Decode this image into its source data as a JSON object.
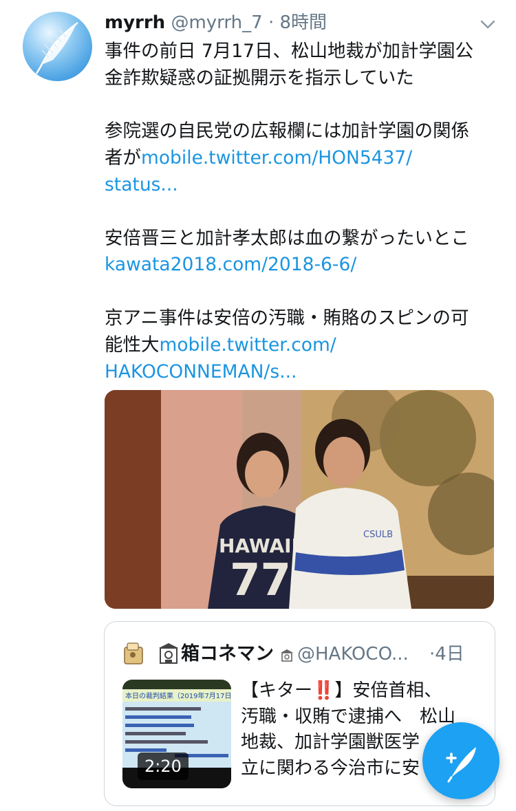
{
  "tweet": {
    "author_name": "myrrh",
    "author_handle": "@myrrh_7",
    "separator": "·",
    "time": "8時間",
    "lines": [
      {
        "parts": [
          {
            "t": "事件の前日 7月17日、松山地裁が加計学園公",
            "link": false
          }
        ]
      },
      {
        "parts": [
          {
            "t": "金詐欺疑惑の証拠開示を指示していた",
            "link": false
          }
        ]
      },
      {
        "gap": true
      },
      {
        "parts": [
          {
            "t": "参院選の自民党の広報欄には加計学園の関係",
            "link": false
          }
        ]
      },
      {
        "parts": [
          {
            "t": "者が",
            "link": false
          },
          {
            "t": "mobile.twitter.com/HON5437/",
            "link": true
          }
        ]
      },
      {
        "parts": [
          {
            "t": "status...",
            "link": true
          }
        ]
      },
      {
        "gap": true
      },
      {
        "parts": [
          {
            "t": "安倍晋三と加計孝太郎は血の繋がったいとこ",
            "link": false
          }
        ]
      },
      {
        "parts": [
          {
            "t": "kawata2018.com/2018-6-6/",
            "link": true
          }
        ]
      },
      {
        "gap": true
      },
      {
        "parts": [
          {
            "t": "京アニ事件は安倍の汚職・賄賂のスピンの可",
            "link": false
          }
        ]
      },
      {
        "parts": [
          {
            "t": "能性大",
            "link": false
          },
          {
            "t": "mobile.twitter.com/",
            "link": true
          }
        ]
      },
      {
        "parts": [
          {
            "t": "HAKOCONNEMAN/s...",
            "link": true
          }
        ]
      }
    ],
    "photo_shirt_left_text": "HAWAII",
    "photo_shirt_left_number": "77",
    "photo_shirt_right_text": "CSULB"
  },
  "quoted": {
    "name": "箱コネマン",
    "handle": "@HAKOCO...",
    "separator": "·",
    "time": "4日",
    "video_duration": "2:20",
    "thumb_caption": "本日の裁判結果（2019年7月17日）",
    "lines": [
      "【キター‼️】安倍首相、",
      "汚職・収賄で逮捕へ　松山",
      "地裁、加計学園獣医学",
      "立に関わる今治市に安"
    ]
  },
  "icons": {
    "more": "chevron-down-icon",
    "compose": "compose-feather-icon"
  },
  "colors": {
    "link": "#1b95e0",
    "secondary": "#657786",
    "fab": "#1da1f2"
  }
}
